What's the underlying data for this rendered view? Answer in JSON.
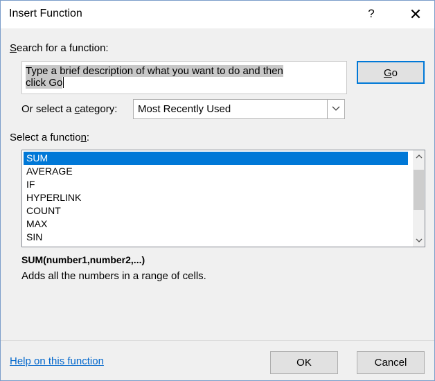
{
  "window": {
    "title": "Insert Function",
    "help_glyph": "?",
    "close_glyph": "✕"
  },
  "search": {
    "label_pre": "",
    "label_accel": "S",
    "label_post": "earch for a function:",
    "value_line1": "Type a brief description of what you want to do and then",
    "value_line2": "click Go",
    "go_accel": "G",
    "go_rest": "o"
  },
  "category": {
    "label_pre": "Or select a ",
    "label_accel": "c",
    "label_post": "ategory:",
    "selected": "Most Recently Used",
    "dropdown_icon": "chevron-down-icon"
  },
  "functions": {
    "label_pre": "Select a functio",
    "label_accel": "n",
    "label_post": ":",
    "items": [
      "SUM",
      "AVERAGE",
      "IF",
      "HYPERLINK",
      "COUNT",
      "MAX",
      "SIN"
    ],
    "selected_index": 0
  },
  "details": {
    "syntax": "SUM(number1,number2,...)",
    "description": "Adds all the numbers in a range of cells."
  },
  "footer": {
    "help_link": "Help on this function",
    "ok_label": "OK",
    "cancel_label": "Cancel"
  },
  "colors": {
    "selection": "#0078d7",
    "link": "#0066cc",
    "dialog_bg": "#f0f0f0"
  }
}
